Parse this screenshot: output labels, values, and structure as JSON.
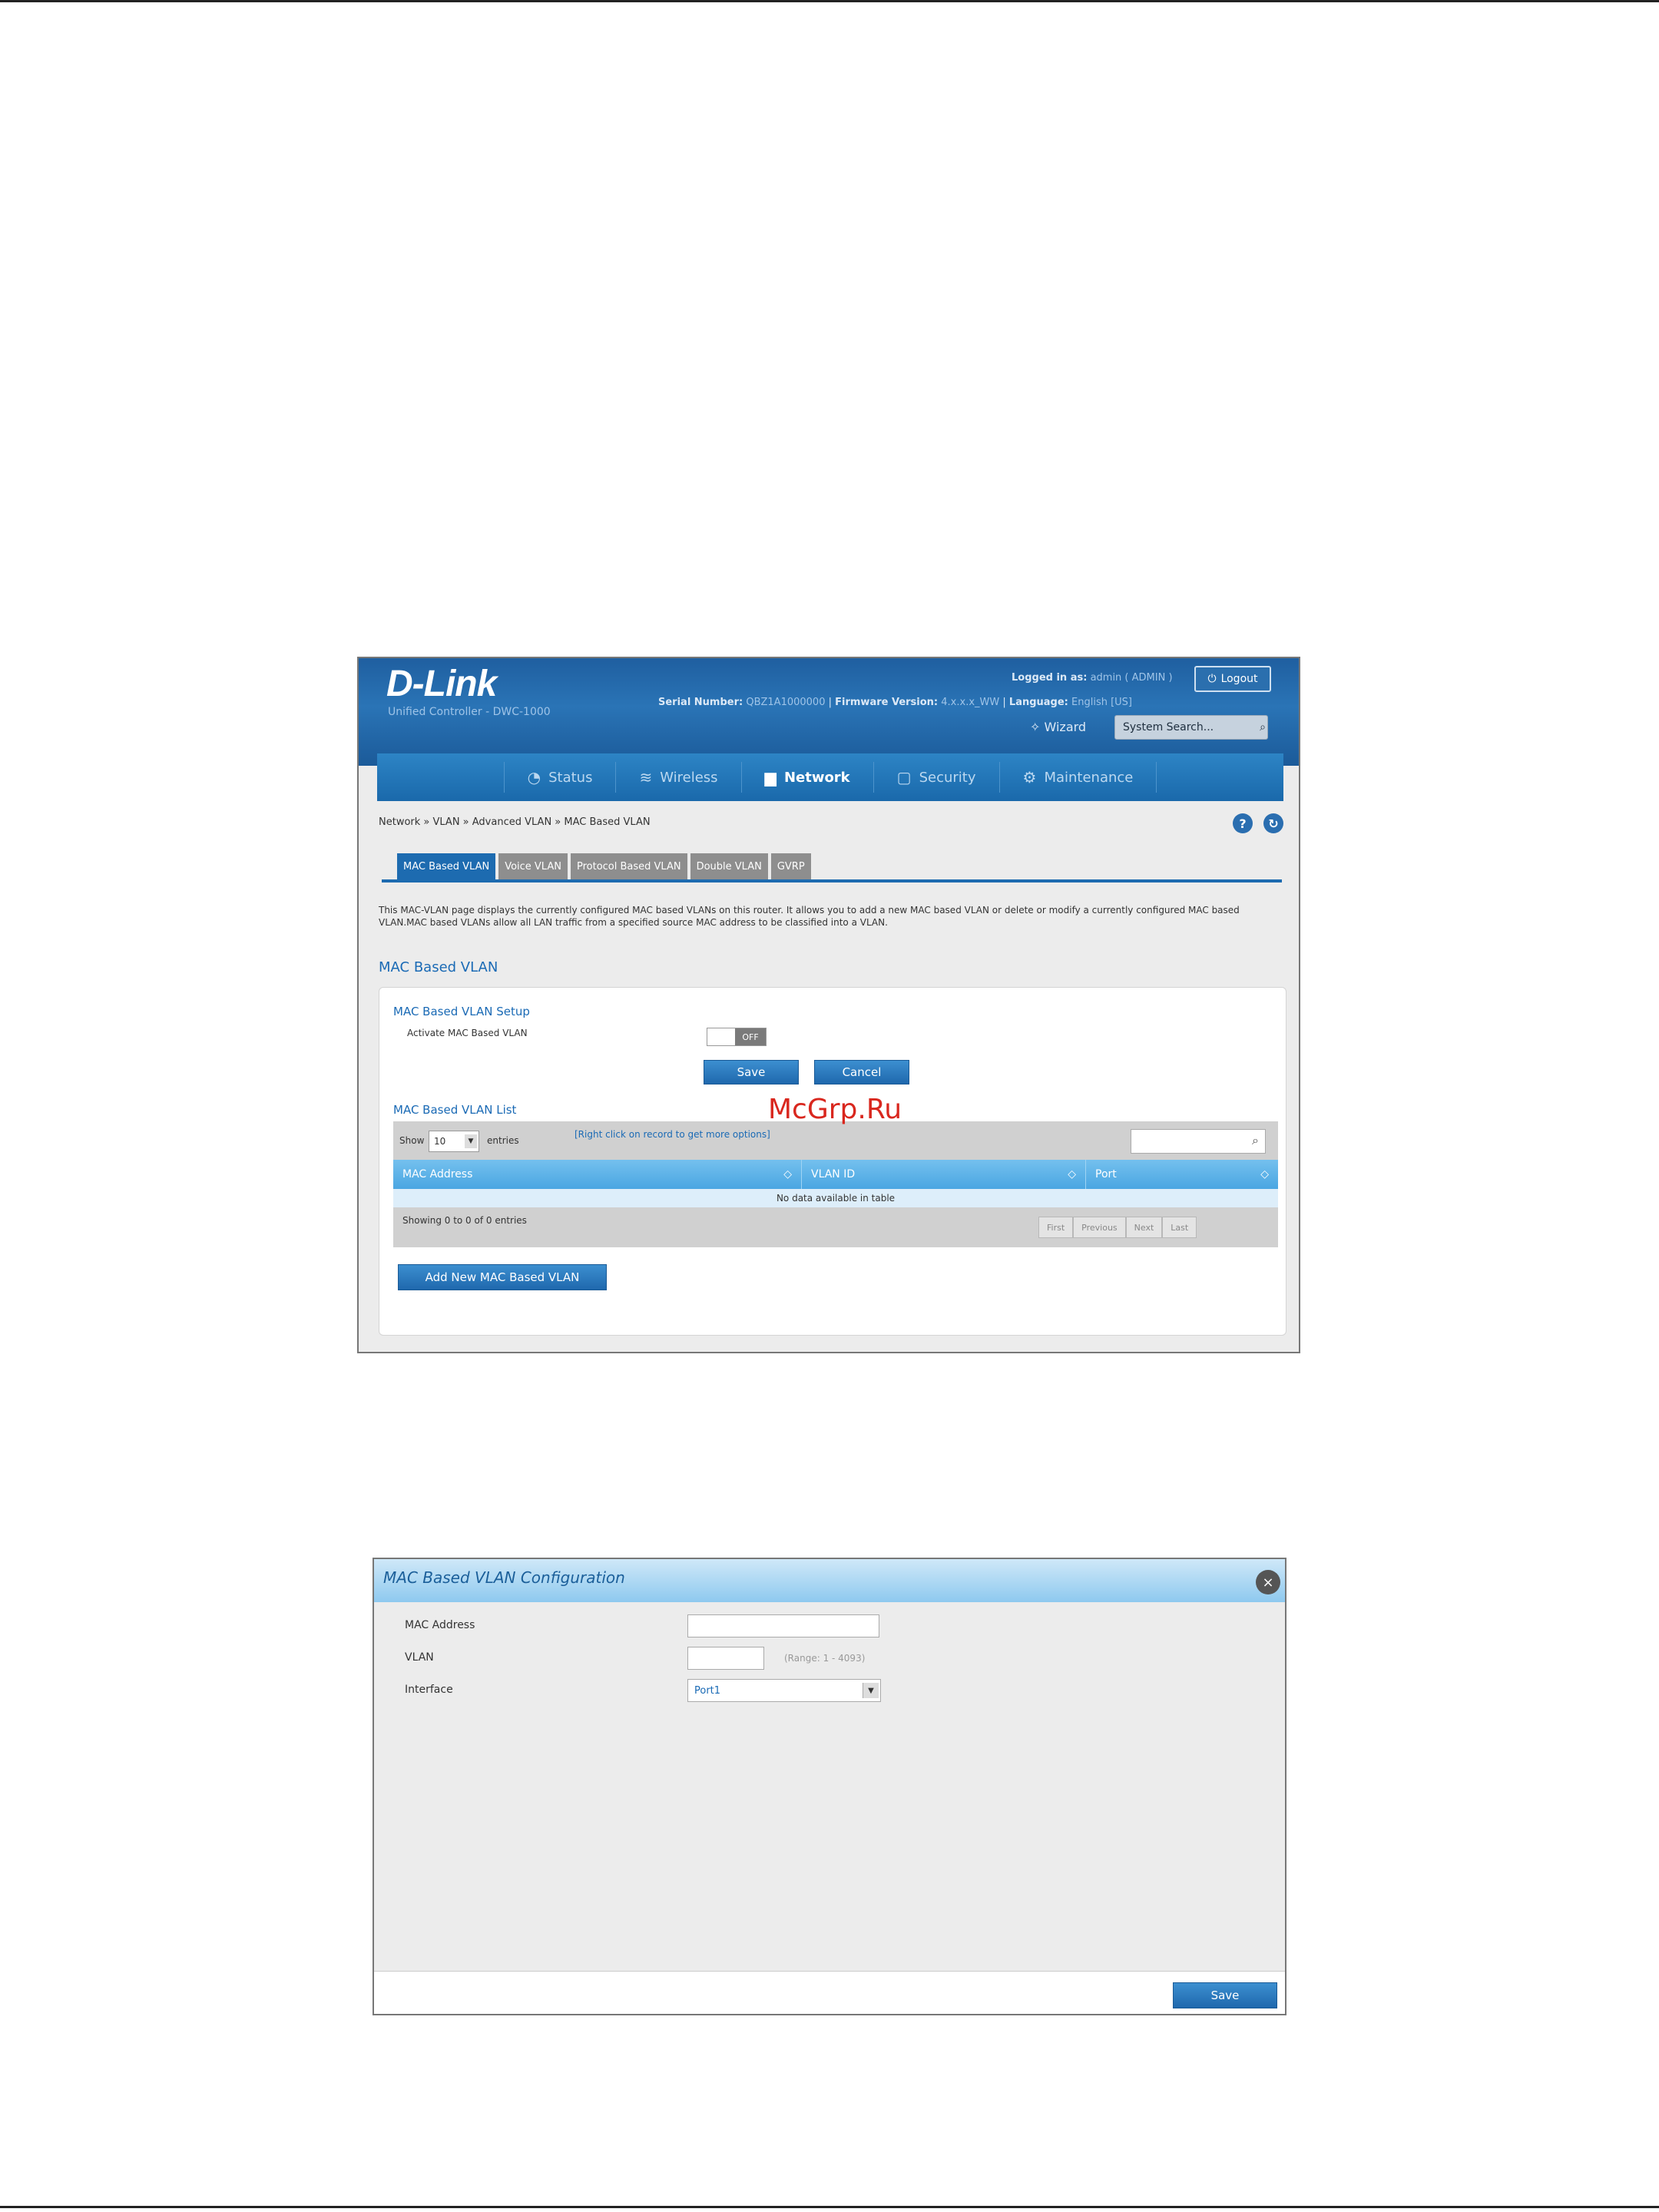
{
  "watermark": "McGrp.Ru",
  "screenshot1": {
    "brand": {
      "logo": "D-Link",
      "subtitle": "Unified Controller - DWC-1000"
    },
    "header": {
      "logged_in_label": "Logged in as:",
      "logged_in_value": "admin ( ADMIN )",
      "logout_label": "Logout",
      "serial_label": "Serial Number:",
      "serial_value": "QBZ1A1000000",
      "firmware_label": "Firmware Version:",
      "firmware_value": "4.x.x.x_WW",
      "language_label": "Language:",
      "language_value": "English [US]",
      "wizard_label": "Wizard",
      "search_label": "System Search..."
    },
    "nav": [
      {
        "label": "Status",
        "icon": "gauge-icon"
      },
      {
        "label": "Wireless",
        "icon": "wifi-icon"
      },
      {
        "label": "Network",
        "icon": "monitor-icon"
      },
      {
        "label": "Security",
        "icon": "lock-icon"
      },
      {
        "label": "Maintenance",
        "icon": "gear-icon"
      }
    ],
    "breadcrumb": "Network  »  VLAN  »  Advanced VLAN  »  MAC Based VLAN",
    "tabs": [
      "MAC Based VLAN",
      "Voice VLAN",
      "Protocol Based VLAN",
      "Double VLAN",
      "GVRP"
    ],
    "description": "This MAC-VLAN page displays the currently configured MAC based VLANs on this router. It allows you to add a new MAC based VLAN or delete or modify a currently configured MAC based VLAN.MAC based VLANs allow all LAN traffic from a specified source MAC address to be classified into a VLAN.",
    "section_title": "MAC Based VLAN",
    "setup": {
      "title": "MAC Based VLAN Setup",
      "activate_label": "Activate MAC Based VLAN",
      "toggle_value": "OFF",
      "save_label": "Save",
      "cancel_label": "Cancel"
    },
    "list": {
      "title": "MAC Based VLAN List",
      "show_label": "Show",
      "show_value": "10",
      "entries_label": "entries",
      "hint": "[Right click on record to get more options]",
      "columns": [
        "MAC Address",
        "VLAN ID",
        "Port"
      ],
      "empty_text": "No data available in table",
      "info": "Showing 0 to 0 of 0 entries",
      "pager": [
        "First",
        "Previous",
        "Next",
        "Last"
      ],
      "add_label": "Add New MAC Based VLAN"
    }
  },
  "screenshot2": {
    "title": "MAC Based VLAN Configuration",
    "fields": {
      "mac_label": "MAC Address",
      "mac_value": "",
      "vlan_label": "VLAN",
      "vlan_value": "",
      "vlan_range": "(Range: 1 - 4093)",
      "interface_label": "Interface",
      "interface_value": "Port1"
    },
    "save_label": "Save"
  }
}
